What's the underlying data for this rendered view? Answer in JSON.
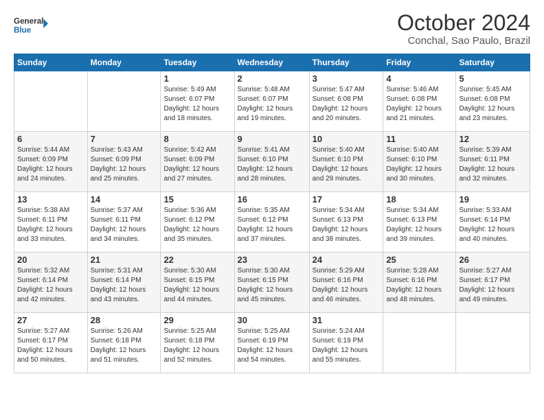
{
  "logo": {
    "line1": "General",
    "line2": "Blue"
  },
  "title": "October 2024",
  "subtitle": "Conchal, Sao Paulo, Brazil",
  "days_header": [
    "Sunday",
    "Monday",
    "Tuesday",
    "Wednesday",
    "Thursday",
    "Friday",
    "Saturday"
  ],
  "weeks": [
    [
      {
        "day": "",
        "info": ""
      },
      {
        "day": "",
        "info": ""
      },
      {
        "day": "1",
        "info": "Sunrise: 5:49 AM\nSunset: 6:07 PM\nDaylight: 12 hours and 18 minutes."
      },
      {
        "day": "2",
        "info": "Sunrise: 5:48 AM\nSunset: 6:07 PM\nDaylight: 12 hours and 19 minutes."
      },
      {
        "day": "3",
        "info": "Sunrise: 5:47 AM\nSunset: 6:08 PM\nDaylight: 12 hours and 20 minutes."
      },
      {
        "day": "4",
        "info": "Sunrise: 5:46 AM\nSunset: 6:08 PM\nDaylight: 12 hours and 21 minutes."
      },
      {
        "day": "5",
        "info": "Sunrise: 5:45 AM\nSunset: 6:08 PM\nDaylight: 12 hours and 23 minutes."
      }
    ],
    [
      {
        "day": "6",
        "info": "Sunrise: 5:44 AM\nSunset: 6:09 PM\nDaylight: 12 hours and 24 minutes."
      },
      {
        "day": "7",
        "info": "Sunrise: 5:43 AM\nSunset: 6:09 PM\nDaylight: 12 hours and 25 minutes."
      },
      {
        "day": "8",
        "info": "Sunrise: 5:42 AM\nSunset: 6:09 PM\nDaylight: 12 hours and 27 minutes."
      },
      {
        "day": "9",
        "info": "Sunrise: 5:41 AM\nSunset: 6:10 PM\nDaylight: 12 hours and 28 minutes."
      },
      {
        "day": "10",
        "info": "Sunrise: 5:40 AM\nSunset: 6:10 PM\nDaylight: 12 hours and 29 minutes."
      },
      {
        "day": "11",
        "info": "Sunrise: 5:40 AM\nSunset: 6:10 PM\nDaylight: 12 hours and 30 minutes."
      },
      {
        "day": "12",
        "info": "Sunrise: 5:39 AM\nSunset: 6:11 PM\nDaylight: 12 hours and 32 minutes."
      }
    ],
    [
      {
        "day": "13",
        "info": "Sunrise: 5:38 AM\nSunset: 6:11 PM\nDaylight: 12 hours and 33 minutes."
      },
      {
        "day": "14",
        "info": "Sunrise: 5:37 AM\nSunset: 6:11 PM\nDaylight: 12 hours and 34 minutes."
      },
      {
        "day": "15",
        "info": "Sunrise: 5:36 AM\nSunset: 6:12 PM\nDaylight: 12 hours and 35 minutes."
      },
      {
        "day": "16",
        "info": "Sunrise: 5:35 AM\nSunset: 6:12 PM\nDaylight: 12 hours and 37 minutes."
      },
      {
        "day": "17",
        "info": "Sunrise: 5:34 AM\nSunset: 6:13 PM\nDaylight: 12 hours and 38 minutes."
      },
      {
        "day": "18",
        "info": "Sunrise: 5:34 AM\nSunset: 6:13 PM\nDaylight: 12 hours and 39 minutes."
      },
      {
        "day": "19",
        "info": "Sunrise: 5:33 AM\nSunset: 6:14 PM\nDaylight: 12 hours and 40 minutes."
      }
    ],
    [
      {
        "day": "20",
        "info": "Sunrise: 5:32 AM\nSunset: 6:14 PM\nDaylight: 12 hours and 42 minutes."
      },
      {
        "day": "21",
        "info": "Sunrise: 5:31 AM\nSunset: 6:14 PM\nDaylight: 12 hours and 43 minutes."
      },
      {
        "day": "22",
        "info": "Sunrise: 5:30 AM\nSunset: 6:15 PM\nDaylight: 12 hours and 44 minutes."
      },
      {
        "day": "23",
        "info": "Sunrise: 5:30 AM\nSunset: 6:15 PM\nDaylight: 12 hours and 45 minutes."
      },
      {
        "day": "24",
        "info": "Sunrise: 5:29 AM\nSunset: 6:16 PM\nDaylight: 12 hours and 46 minutes."
      },
      {
        "day": "25",
        "info": "Sunrise: 5:28 AM\nSunset: 6:16 PM\nDaylight: 12 hours and 48 minutes."
      },
      {
        "day": "26",
        "info": "Sunrise: 5:27 AM\nSunset: 6:17 PM\nDaylight: 12 hours and 49 minutes."
      }
    ],
    [
      {
        "day": "27",
        "info": "Sunrise: 5:27 AM\nSunset: 6:17 PM\nDaylight: 12 hours and 50 minutes."
      },
      {
        "day": "28",
        "info": "Sunrise: 5:26 AM\nSunset: 6:18 PM\nDaylight: 12 hours and 51 minutes."
      },
      {
        "day": "29",
        "info": "Sunrise: 5:25 AM\nSunset: 6:18 PM\nDaylight: 12 hours and 52 minutes."
      },
      {
        "day": "30",
        "info": "Sunrise: 5:25 AM\nSunset: 6:19 PM\nDaylight: 12 hours and 54 minutes."
      },
      {
        "day": "31",
        "info": "Sunrise: 5:24 AM\nSunset: 6:19 PM\nDaylight: 12 hours and 55 minutes."
      },
      {
        "day": "",
        "info": ""
      },
      {
        "day": "",
        "info": ""
      }
    ]
  ]
}
